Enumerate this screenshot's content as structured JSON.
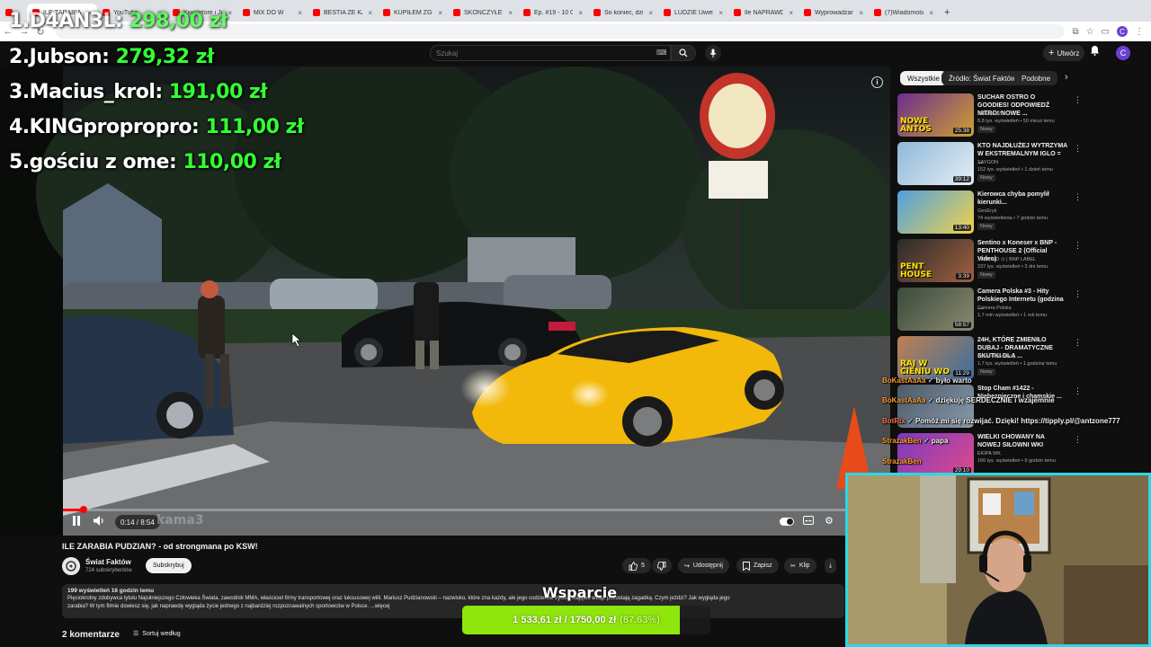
{
  "browser": {
    "tabs": [
      {
        "label": "",
        "color": "#ff0000"
      },
      {
        "label": "ILE ZARABIA P",
        "active": true
      },
      {
        "label": "YouTube"
      },
      {
        "label": "Kiwalefore i Jej Al"
      },
      {
        "label": "MIX DO W"
      },
      {
        "label": "BESTIA ZE KADE"
      },
      {
        "label": "KUPIŁEM ZGUBIO"
      },
      {
        "label": "SKOŃCZYŁEM B"
      },
      {
        "label": "Ep. #19 - 10 000"
      },
      {
        "label": "So koniec, dzięk"
      },
      {
        "label": "LUDZIE Uwielbi"
      },
      {
        "label": "Ile NAPRAWDĘ Z"
      },
      {
        "label": "Wyprowadzamy"
      },
      {
        "label": "(7)Wiadomości |"
      }
    ],
    "avatar_letter": "C"
  },
  "youtube_header": {
    "search_placeholder": "Szukaj",
    "create_label": "Utwórz",
    "avatar_letter": "C"
  },
  "leaderboard": [
    {
      "rank": "1.",
      "name": "D4AN3L:",
      "amount": "298,00 zł"
    },
    {
      "rank": "2.",
      "name": "Jubson:",
      "amount": "279,32 zł"
    },
    {
      "rank": "3.",
      "name": "Macius_krol:",
      "amount": "191,00 zł"
    },
    {
      "rank": "4.",
      "name": "KINGpropropro:",
      "amount": "111,00 zł"
    },
    {
      "rank": "5.",
      "name": "gościu z ome:",
      "amount": "110,00 zł"
    }
  ],
  "player": {
    "time": "0:14 / 8:54",
    "progress": 0.026,
    "watermark": "kama3"
  },
  "sidebar": {
    "chips": [
      "Wszystkie",
      "Źródło: Świat Faktów",
      "Podobne"
    ],
    "recs": [
      {
        "title": "SUCHAR OSTRO O GOODIES! ODPOWIEDŹ NITRO! NOWE ...",
        "channel": "SzklanaYZJ",
        "meta": "8,8 tys. wyświetleń • 50 minut temu",
        "badge": "Nowy",
        "duration": "25:38",
        "thumb_text": "NOWE ANTOS",
        "c1": "#6a2d8f",
        "c2": "#d0a030"
      },
      {
        "title": "KTO NAJDŁUŻEJ WYTRZYMA W EKSTREMALNYM IGLO = ...",
        "channel": "SAYGON",
        "meta": "152 tys. wyświetleń • 1 dzień temu",
        "badge": "Nowy",
        "duration": "39:12",
        "thumb_text": "",
        "c1": "#8fb8d8",
        "c2": "#e6eef5"
      },
      {
        "title": "Kierowca chyba pomylił kierunki...",
        "channel": "GeoEryk",
        "meta": "74 wyświetlenia • 7 godzin temu",
        "badge": "Nowy",
        "duration": "13:40",
        "thumb_text": "",
        "c1": "#4fa0e0",
        "c2": "#f2d24a"
      },
      {
        "title": "Sentino x Koneser x BNP - PENTHOUSE 2 (Official Video)",
        "channel": "SENTINO ⊙ | BNP LABEL",
        "meta": "237 tys. wyświetleń • 3 dni temu",
        "badge": "Nowy",
        "duration": "3:39",
        "thumb_text": "PENT HOUSE",
        "c1": "#2a2a2a",
        "c2": "#a06040"
      },
      {
        "title": "Camera Polska #3 - Hity Polskiego Internetu (godzina ...",
        "channel": "Camera Polska",
        "meta": "1,7 mln wyświetleń • 1 rok temu",
        "badge": "",
        "duration": "58:57",
        "thumb_text": "",
        "c1": "#3a4a3a",
        "c2": "#8a8a70"
      },
      {
        "title": "24H, KTÓRE ZMIENIŁO DUBAJ - DRAMATYCZNE SKUTKI DLA ...",
        "channel": "Kanał Biznesowy",
        "meta": "1,7 tys. wyświetleń • 1 godzinę temu",
        "badge": "Nowy",
        "duration": "11:29",
        "thumb_text": "RAJ W CIENIU WO",
        "c1": "#c08050",
        "c2": "#3a6fa0"
      },
      {
        "title": "Stop Cham #1422 - Niebezpieczne i chamskie ...",
        "channel": "",
        "meta": "",
        "badge": "",
        "duration": "",
        "thumb_text": "",
        "c1": "#4a5a6a",
        "c2": "#8a9aaa"
      },
      {
        "title": "WIELKI CHOWANY NA NOWEJ SIŁOWNI WKI",
        "channel": "EKIPA WK",
        "meta": "166 tys. wyświetleń • 9 godzin temu",
        "badge": "",
        "duration": "29:10",
        "thumb_text": "",
        "c1": "#7a3ac0",
        "c2": "#e04a8a"
      }
    ]
  },
  "chat": [
    {
      "user": "BoKastAaAa",
      "message": "było warto"
    },
    {
      "user": "BoKastAaAa",
      "message": "dziękuję SERDECZNIE i wzajemnie"
    },
    {
      "user": "BotRix",
      "message": "Pomóż mi się rozwijać. Dzięki! https://tipply.pl/@antzone777"
    },
    {
      "user": "StrazakBen",
      "message": "papa"
    },
    {
      "user": "StrazakBen",
      "message": ""
    }
  ],
  "video": {
    "title": "ILE ZARABIA PUDZIAN? - od strongmana po KSW!",
    "channel": "Świat Faktów",
    "subscribers": "724 subskrybentów",
    "subscribe_label": "Subskrybuj",
    "likes": "5",
    "share_label": "Udostępnij",
    "save_label": "Zapisz",
    "clip_label": "Klip",
    "views_line": "199 wyświetleń  16 godzin temu",
    "description": "Pięciokrotny zdobywca tytułu Najsilniejszego Człowieka Świata, zawodnik MMA, właściciel firmy transportowej oraz luksusowej willi. Mariusz Pudzianowski – nazwisko, które zna każdy, ale jego codzienne życie i majątek wciąż pozostają zagadką. Czym jeździ? Jak wygląda jego",
    "description2": "zarabia? W tym filmie dowiesz się, jak naprawdę wygląda życie jednego z najbardziej rozpoznawalnych sportowców w Polsce. ...więcej",
    "comments": "2 komentarze",
    "sort_label": "Sortuj według"
  },
  "donation_goal": {
    "label": "Wsparcie",
    "current": "1 533,61 zł",
    "separator": "/",
    "target": "1750,00 zł",
    "percent_text": "(87.63%)",
    "fraction": 0.8763
  },
  "colors": {
    "amount_green": "#33ff33",
    "goal_fill": "#8ee60c",
    "webcam_border": "#29d8e6",
    "yt_red": "#ff0000"
  }
}
